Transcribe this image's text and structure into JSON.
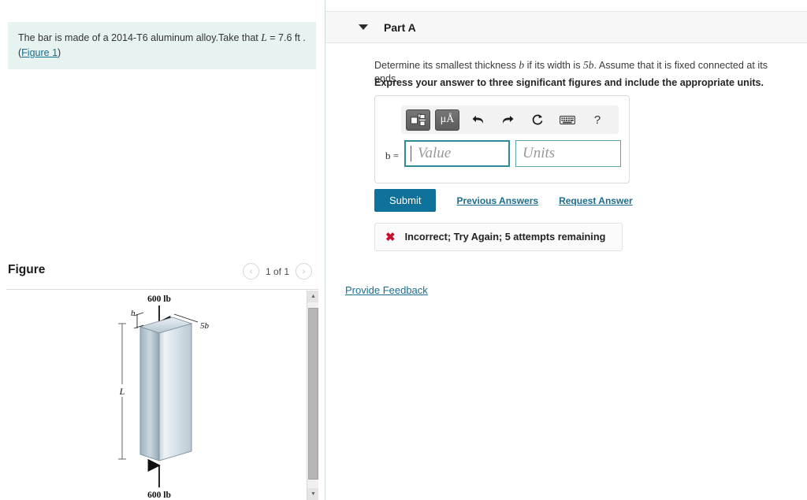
{
  "problem": {
    "text_before_var": "The bar is made of a 2014-T6 aluminum alloy.Take that ",
    "variable": "L",
    "text_after_var": " = 7.6  ft  .",
    "figure_link": "Figure 1",
    "paren_open": "(",
    "paren_close": ")"
  },
  "figure": {
    "title": "Figure",
    "counter": "1 of 1",
    "prev_icon": "chevron-left-icon",
    "next_icon": "chevron-right-icon",
    "prev_glyph": "‹",
    "next_glyph": "›",
    "scroll_up_glyph": "▲",
    "scroll_down_glyph": "▼",
    "diagram": {
      "top_load_label": "600 lb",
      "bottom_load_label": "600 lb",
      "thickness_label": "b",
      "width_label": "5b",
      "length_label": "L"
    }
  },
  "part_a": {
    "title": "Part A",
    "toggle_icon": "triangle-down-icon",
    "question_part1": "Determine its smallest thickness ",
    "question_var1": "b",
    "question_part2": " if its width is ",
    "question_var2": "5b",
    "question_part3": ". Assume that it is fixed connected at its ends.",
    "instruction": "Express your answer to three significant figures and include the appropriate units."
  },
  "answer": {
    "variable_label": "b =",
    "value_placeholder": "Value",
    "value": "",
    "units_placeholder": "Units",
    "units": "",
    "toolbar": {
      "template_icon": "math-template-icon",
      "units_icon": "units-micro-angstrom-icon",
      "units_label": "μÅ",
      "undo_icon": "undo-arrow-icon",
      "undo_glyph": "↶",
      "redo_icon": "redo-arrow-icon",
      "redo_glyph": "↷",
      "reset_icon": "reset-circle-icon",
      "reset_glyph": "⟳",
      "keyboard_icon": "keyboard-icon",
      "keyboard_glyph": "⌨",
      "help_icon": "help-question-icon",
      "help_glyph": "?"
    }
  },
  "actions": {
    "submit_label": "Submit",
    "previous_answers_label": "Previous Answers",
    "request_answer_label": "Request Answer",
    "provide_feedback_label": "Provide Feedback"
  },
  "feedback": {
    "icon": "incorrect-x-icon",
    "icon_glyph": "✖",
    "message": "Incorrect; Try Again; 5 attempts remaining"
  },
  "colors": {
    "statement_bg": "#e7f3f1",
    "link": "#1a6e8e",
    "submit_bg": "#10729b",
    "error": "#c8102e",
    "field_focus_border": "#2e8b9a"
  }
}
